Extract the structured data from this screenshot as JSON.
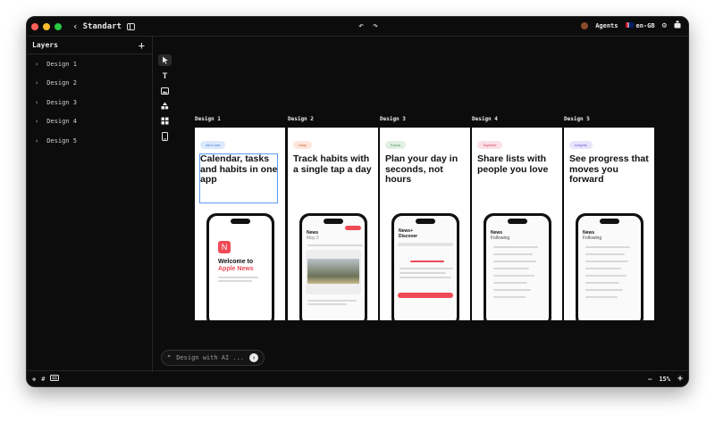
{
  "titlebar": {
    "back_icon": "chevron-left-icon",
    "project_name": "Standart",
    "sidebar_toggle_icon": "sidebar-icon",
    "undo_icon": "undo-icon",
    "redo_icon": "redo-icon",
    "agents_label": "Agents",
    "locale_label": "en-GB",
    "settings_icon": "gear-icon",
    "export_icon": "share-icon"
  },
  "sidebar": {
    "title": "Layers",
    "add_icon": "plus-icon",
    "layers": [
      {
        "label": "Design 1"
      },
      {
        "label": "Design 2"
      },
      {
        "label": "Design 3"
      },
      {
        "label": "Design 4"
      },
      {
        "label": "Design 5"
      }
    ]
  },
  "tools": [
    {
      "name": "pointer-icon",
      "active": true
    },
    {
      "name": "text-icon",
      "active": false
    },
    {
      "name": "image-icon",
      "active": false
    },
    {
      "name": "shapes-icon",
      "active": false
    },
    {
      "name": "components-icon",
      "active": false
    },
    {
      "name": "device-icon",
      "active": false
    }
  ],
  "frames": [
    {
      "label": "Design 1",
      "pill": "All in one",
      "pill_bg": "#dbe9fb",
      "pill_fg": "#3b6fd1",
      "headline": "Calendar, tasks and habits in one app",
      "screen_title": "Welcome to",
      "screen_accent": "Apple News"
    },
    {
      "label": "Design 2",
      "pill": "Daily",
      "pill_bg": "#fde6dd",
      "pill_fg": "#d4613b",
      "headline": "Track habits with a single tap a day",
      "screen_title": "News",
      "screen_accent": "May 2"
    },
    {
      "label": "Design 3",
      "pill": "Focus",
      "pill_bg": "#e1efe3",
      "pill_fg": "#3d8a4f",
      "headline": "Plan your day in seconds, not hours",
      "screen_title": "News+",
      "screen_accent": "Discover"
    },
    {
      "label": "Design 4",
      "pill": "Together",
      "pill_bg": "#fbe0e6",
      "pill_fg": "#cf4466",
      "headline": "Share lists with people you love",
      "screen_title": "News",
      "screen_accent": "Following"
    },
    {
      "label": "Design 5",
      "pill": "Insights",
      "pill_bg": "#e8e4fb",
      "pill_fg": "#6a55d6",
      "headline": "See progress that moves you forward",
      "screen_title": "News",
      "screen_accent": "Following"
    }
  ],
  "ai_prompt": {
    "placeholder": "Design with AI ...",
    "expand_icon": "chevron-up-icon",
    "send_icon": "arrow-up-icon"
  },
  "statusbar": {
    "zoom": "15%",
    "zoom_out_icon": "minus-icon",
    "zoom_in_icon": "plus-icon",
    "left_icons": [
      "move-icon",
      "grid-icon",
      "keyboard-icon"
    ]
  },
  "colors": {
    "background": "#0c0c0c",
    "selection": "#5b9bf5",
    "news_red": "#ef4a55"
  }
}
